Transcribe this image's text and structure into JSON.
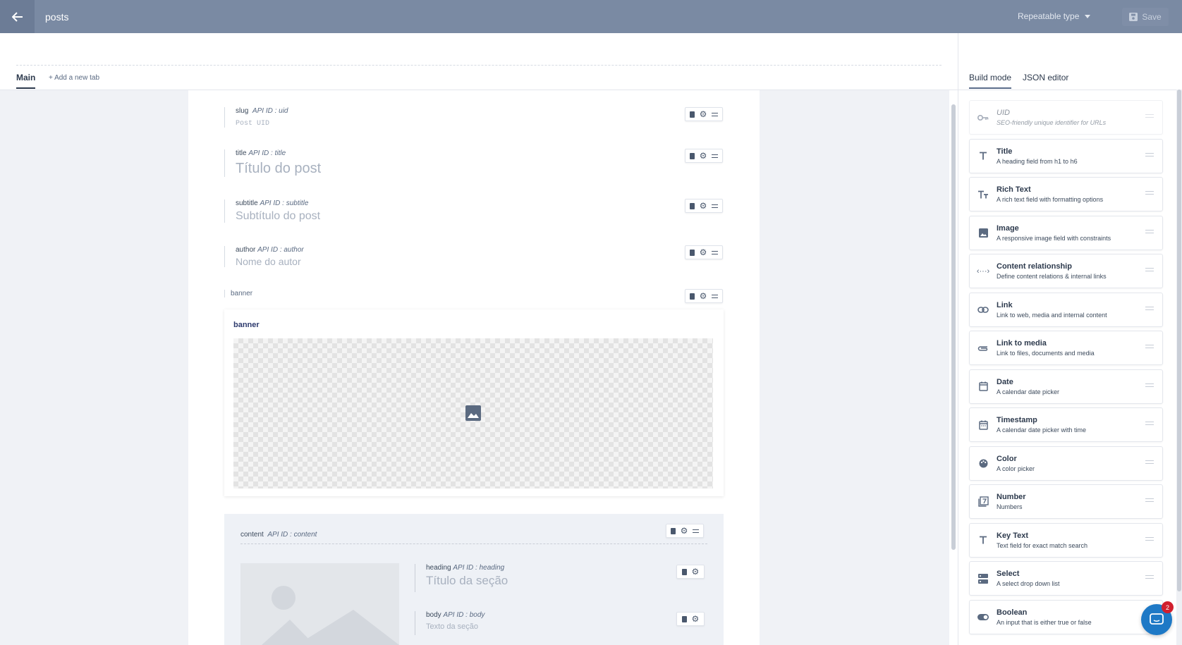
{
  "header": {
    "title": "posts",
    "type_select": "Repeatable type",
    "save_label": "Save"
  },
  "tabs": {
    "main": "Main",
    "add": "Add a new tab"
  },
  "builder": {
    "fields": [
      {
        "name": "slug",
        "api": "API ID : uid",
        "placeholder": "Post UID"
      },
      {
        "name": "title",
        "api": "API ID : title",
        "placeholder": "Título do post"
      },
      {
        "name": "subtitle",
        "api": "API ID : subtitle",
        "placeholder": "Subtítulo do post"
      },
      {
        "name": "author",
        "api": "API ID : author",
        "placeholder": "Nome do autor"
      }
    ],
    "banner": {
      "label": "banner",
      "title": "banner"
    },
    "group": {
      "name": "content",
      "api": "API ID : content",
      "fields": [
        {
          "name": "heading",
          "api": "API ID : heading",
          "placeholder": "Título da seção"
        },
        {
          "name": "body",
          "api": "API ID : body",
          "placeholder": "Texto da seção"
        }
      ]
    }
  },
  "right_panel": {
    "tabs": [
      "Build mode",
      "JSON editor"
    ],
    "items": [
      {
        "name": "UID",
        "desc": "SEO-friendly unique identifier for URLs",
        "icon": "key-icon"
      },
      {
        "name": "Title",
        "desc": "A heading field from h1 to h6",
        "icon": "text-icon"
      },
      {
        "name": "Rich Text",
        "desc": "A rich text field with formatting options",
        "icon": "rich-text-icon"
      },
      {
        "name": "Image",
        "desc": "A responsive image field with constraints",
        "icon": "image-icon"
      },
      {
        "name": "Content relationship",
        "desc": "Define content relations & internal links",
        "icon": "relationship-icon"
      },
      {
        "name": "Link",
        "desc": "Link to web, media and internal content",
        "icon": "link-icon"
      },
      {
        "name": "Link to media",
        "desc": "Link to files, documents and media",
        "icon": "attachment-icon"
      },
      {
        "name": "Date",
        "desc": "A calendar date picker",
        "icon": "calendar-icon"
      },
      {
        "name": "Timestamp",
        "desc": "A calendar date picker with time",
        "icon": "calendar-clock-icon"
      },
      {
        "name": "Color",
        "desc": "A color picker",
        "icon": "palette-icon"
      },
      {
        "name": "Number",
        "desc": "Numbers",
        "icon": "number-icon"
      },
      {
        "name": "Key Text",
        "desc": "Text field for exact match search",
        "icon": "key-text-icon"
      },
      {
        "name": "Select",
        "desc": "A select drop down list",
        "icon": "select-icon"
      },
      {
        "name": "Boolean",
        "desc": "An input that is either true or false",
        "icon": "toggle-icon"
      }
    ]
  },
  "chat": {
    "badge": "2"
  }
}
